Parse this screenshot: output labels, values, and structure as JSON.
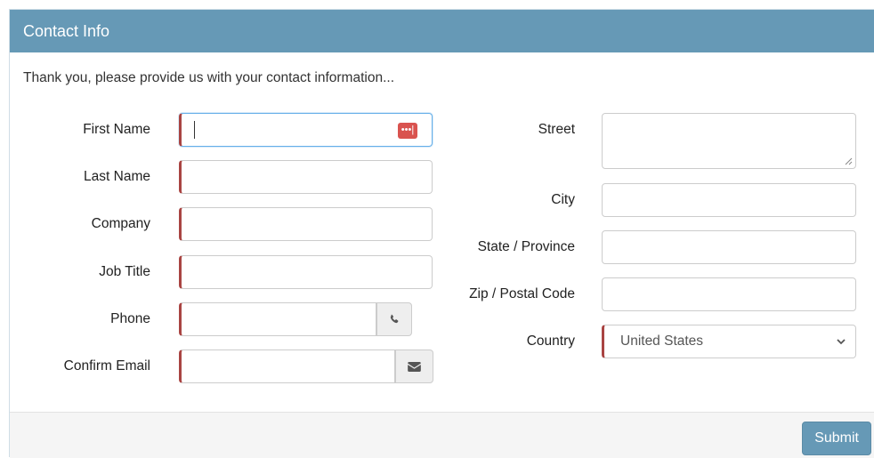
{
  "panel": {
    "title": "Contact Info"
  },
  "intro": "Thank you, please provide us with your contact information...",
  "left_fields": [
    {
      "label": "First Name",
      "value": "",
      "icon": "password-manager-icon"
    },
    {
      "label": "Last Name",
      "value": ""
    },
    {
      "label": "Company",
      "value": ""
    },
    {
      "label": "Job Title",
      "value": ""
    },
    {
      "label": "Phone",
      "value": "",
      "icon": "phone-icon"
    },
    {
      "label": "Confirm Email",
      "value": "",
      "icon": "envelope-icon"
    }
  ],
  "right_fields": [
    {
      "label": "Street",
      "value": ""
    },
    {
      "label": "City",
      "value": ""
    },
    {
      "label": "State / Province",
      "value": ""
    },
    {
      "label": "Zip / Postal Code",
      "value": ""
    },
    {
      "label": "Country",
      "selected": "United States"
    }
  ],
  "footer": {
    "submit_label": "Submit"
  },
  "colors": {
    "header": "#6699b6",
    "required": "#a94442",
    "focus": "#66afe9",
    "submit": "#6699b6"
  }
}
